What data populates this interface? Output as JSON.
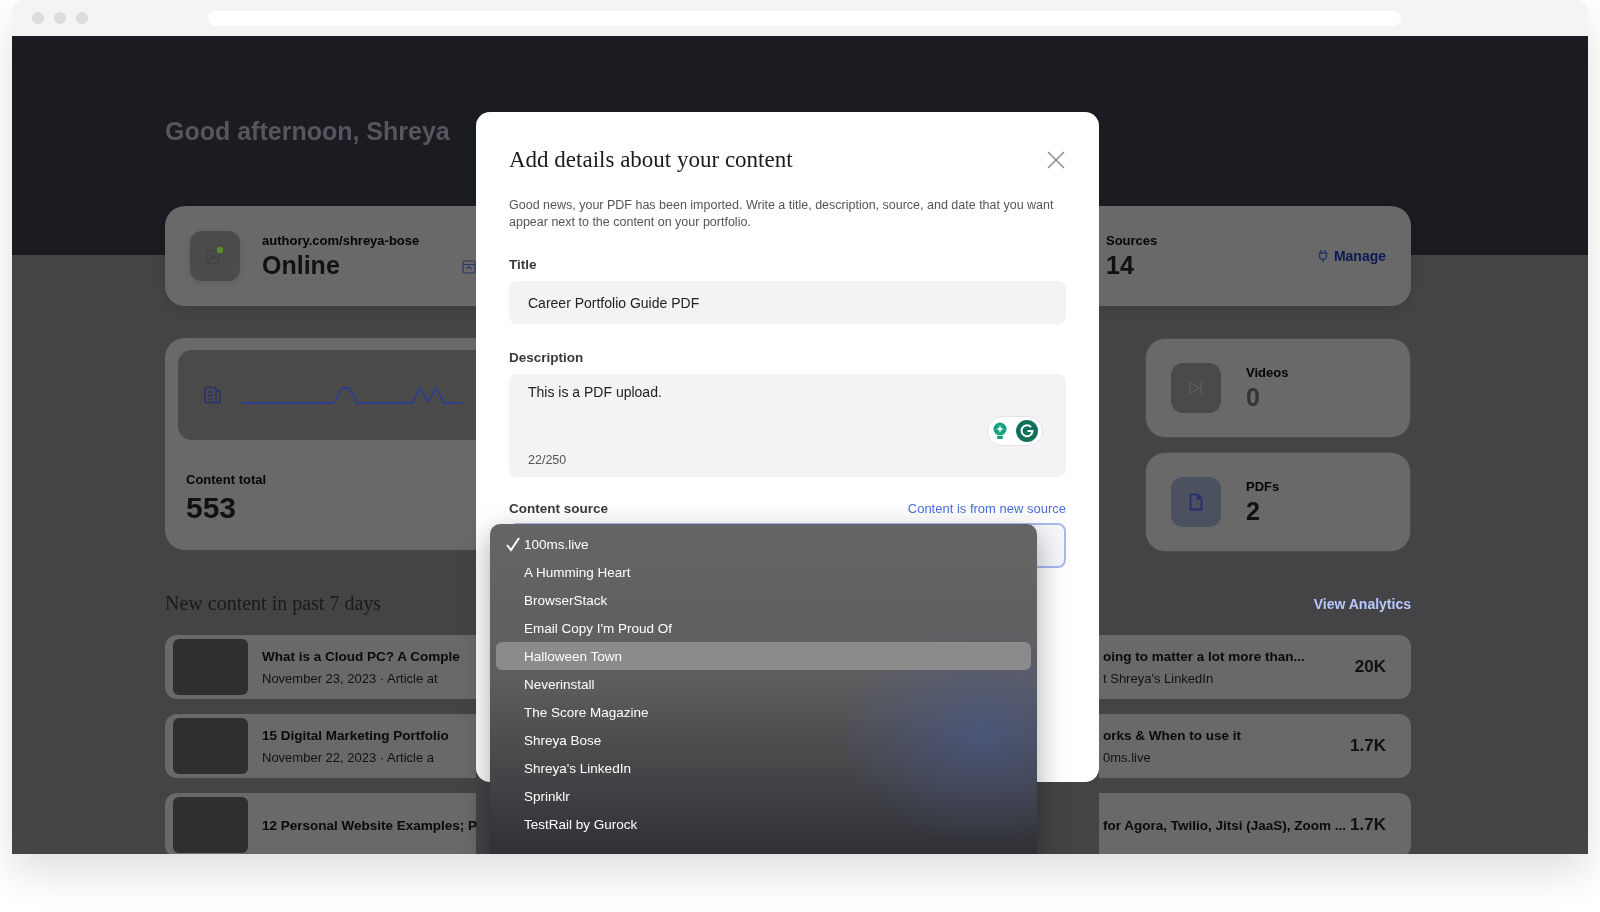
{
  "greeting": "Good afternoon, Shreya",
  "profile": {
    "url": "authory.com/shreya-bose",
    "status": "Online",
    "sources_label": "Sources",
    "sources_count": "14",
    "manage": "Manage"
  },
  "content_total": {
    "label": "Content total",
    "value": "553"
  },
  "stats": [
    {
      "kind": "video",
      "label": "Videos",
      "value": "0"
    },
    {
      "kind": "pdf",
      "label": "PDFs",
      "value": "2"
    }
  ],
  "recent": {
    "title": "New content in past 7 days",
    "link": "View Analytics",
    "rows": [
      {
        "title": "What is a Cloud PC? A Comple",
        "subtitle": "November 23, 2023  ·  Article at",
        "title_end": "oing to matter a lot more than...",
        "subtitle_end": "t Shreya's LinkedIn",
        "count": "20K"
      },
      {
        "title": "15 Digital Marketing Portfolio",
        "subtitle": "November 22, 2023  ·  Article a",
        "title_end": "orks & When to use it",
        "subtitle_end": "0ms.live",
        "count": "1.7K"
      },
      {
        "title": "12 Personal Website Examples; P",
        "title_end": "for Agora, Twilio, Jitsi (JaaS), Zoom ...",
        "count": "1.7K"
      }
    ]
  },
  "modal": {
    "title": "Add details about your content",
    "intro": "Good news, your PDF has been imported. Write a title, description, source, and date that you want appear next to the content on your portfolio.",
    "title_label": "Title",
    "title_value": "Career Portfolio Guide PDF",
    "description_label": "Description",
    "description_value": "This is a PDF upload.",
    "counter": "22/250",
    "source_label": "Content source",
    "source_link": "Content is from new source",
    "source_options": [
      {
        "label": "100ms.live",
        "selected": true,
        "highlighted": false
      },
      {
        "label": "A Humming Heart",
        "selected": false,
        "highlighted": false
      },
      {
        "label": "BrowserStack",
        "selected": false,
        "highlighted": false
      },
      {
        "label": "Email Copy I'm Proud Of",
        "selected": false,
        "highlighted": false
      },
      {
        "label": "Halloween Town",
        "selected": false,
        "highlighted": true
      },
      {
        "label": "Neverinstall",
        "selected": false,
        "highlighted": false
      },
      {
        "label": "The Score Magazine",
        "selected": false,
        "highlighted": false
      },
      {
        "label": "Shreya Bose",
        "selected": false,
        "highlighted": false
      },
      {
        "label": "Shreya's LinkedIn",
        "selected": false,
        "highlighted": false
      },
      {
        "label": "Sprinklr",
        "selected": false,
        "highlighted": false
      },
      {
        "label": "TestRail by Gurock",
        "selected": false,
        "highlighted": false
      }
    ]
  }
}
